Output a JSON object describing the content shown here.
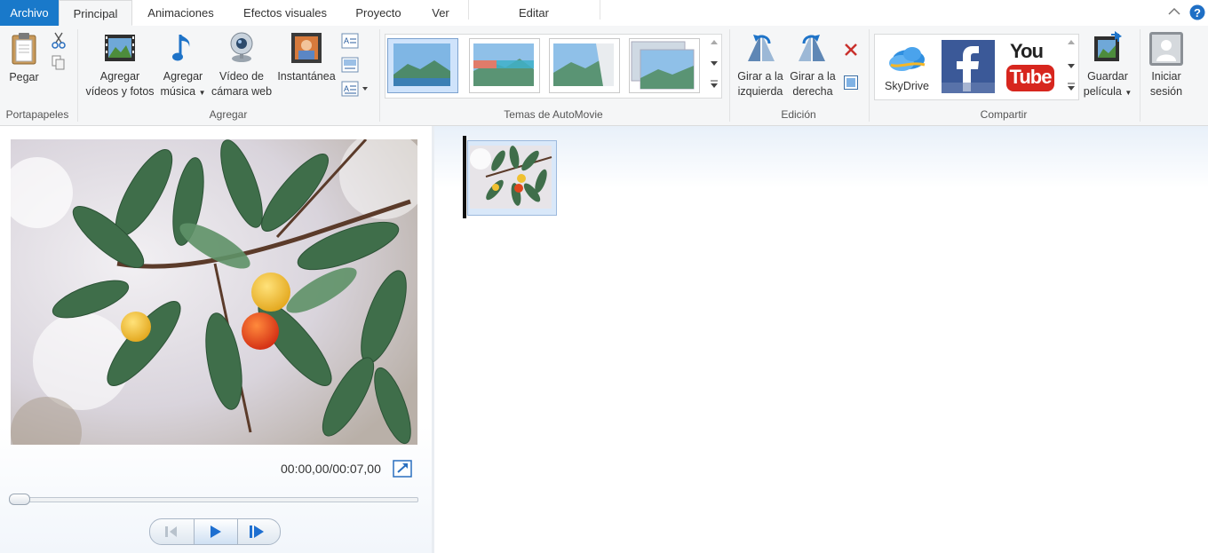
{
  "tabs": {
    "file": "Archivo",
    "home": "Principal",
    "animations": "Animaciones",
    "visual_effects": "Efectos visuales",
    "project": "Proyecto",
    "view": "Ver",
    "edit": "Editar"
  },
  "ribbon": {
    "clipboard": {
      "paste": "Pegar",
      "group": "Portapapeles"
    },
    "add": {
      "add_videos_1": "Agregar",
      "add_videos_2": "vídeos y fotos",
      "add_music_1": "Agregar",
      "add_music_2": "música",
      "webcam_1": "Vídeo de",
      "webcam_2": "cámara web",
      "snapshot": "Instantánea",
      "group": "Agregar"
    },
    "themes": {
      "group": "Temas de AutoMovie"
    },
    "editing": {
      "rotate_left_1": "Girar a la",
      "rotate_left_2": "izquierda",
      "rotate_right_1": "Girar a la",
      "rotate_right_2": "derecha",
      "group": "Edición"
    },
    "share": {
      "skydrive": "SkyDrive",
      "youtube_you": "You",
      "youtube_tube": "Tube",
      "save_movie_1": "Guardar",
      "save_movie_2": "película",
      "group": "Compartir"
    },
    "signin": {
      "line1": "Iniciar",
      "line2": "sesión"
    }
  },
  "preview": {
    "time": "00:00,00/00:07,00",
    "progress": 0.0
  },
  "colors": {
    "file_tab": "#1979ca",
    "accent_blue": "#2a7fd4",
    "youtube_red": "#d7261e",
    "facebook_blue": "#3b5998"
  }
}
